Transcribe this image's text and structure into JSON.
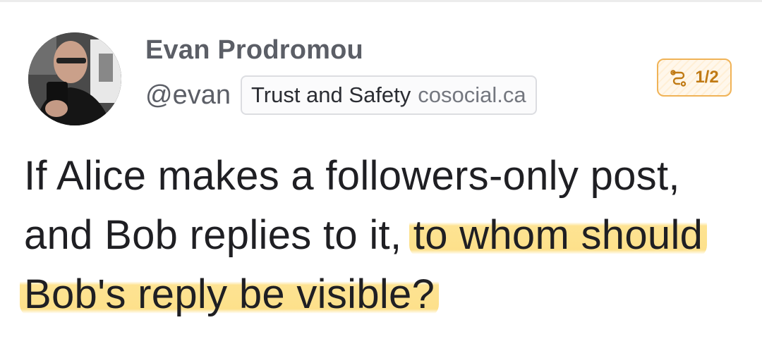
{
  "post": {
    "author": {
      "display_name": "Evan Prodromou",
      "handle": "@evan",
      "domain_chip": {
        "name": "Trust and Safety",
        "host": "cosocial.ca"
      }
    },
    "thread_badge": {
      "icon": "thread-icon",
      "count": "1/2"
    },
    "body": {
      "plain_part": "If Alice makes a followers-only post, and Bob replies to it, ",
      "highlighted_part": "to whom should Bob's reply be visible?"
    }
  },
  "colors": {
    "name_text": "#5b5e66",
    "body_text": "#1f1f23",
    "badge_accent": "#c07a14",
    "highlight": "#fcd664"
  }
}
